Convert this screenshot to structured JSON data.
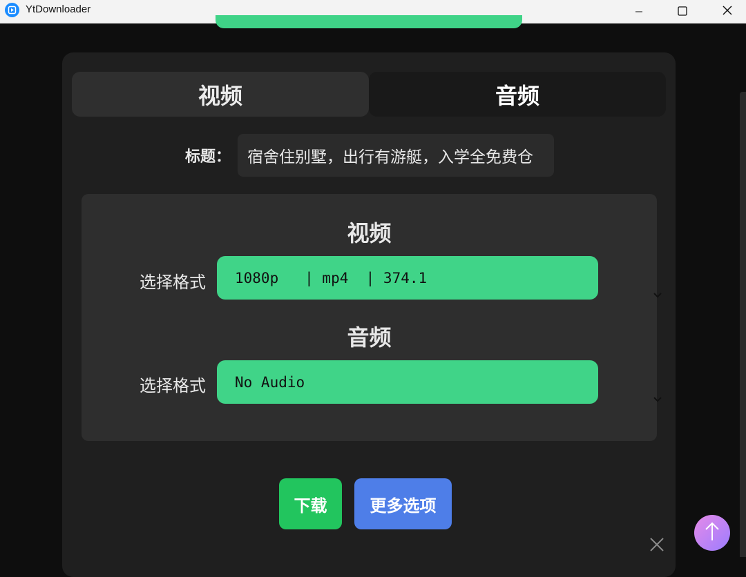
{
  "window": {
    "title": "YtDownloader",
    "icons": [
      "app-icon",
      "minimize-icon",
      "maximize-icon",
      "close-icon"
    ]
  },
  "tabs": [
    {
      "label": "视频",
      "active": true
    },
    {
      "label": "音频",
      "active": false
    }
  ],
  "title_field": {
    "label": "标题",
    "separator": "：",
    "value": "宿舍住别墅，出行有游艇，入学全免费仓"
  },
  "video_section": {
    "heading": "视频",
    "format_label": "选择格式",
    "selected_format": "1080p   | mp4  | 374.1"
  },
  "audio_section": {
    "heading": "音频",
    "format_label": "选择格式",
    "selected_format": "No Audio"
  },
  "actions": {
    "download_label": "下载",
    "more_options_label": "更多选项"
  },
  "colors": {
    "accent_green": "#40d488",
    "download_green": "#22c55e",
    "more_blue": "#4e7ee8",
    "background": "#0e0e0e"
  }
}
